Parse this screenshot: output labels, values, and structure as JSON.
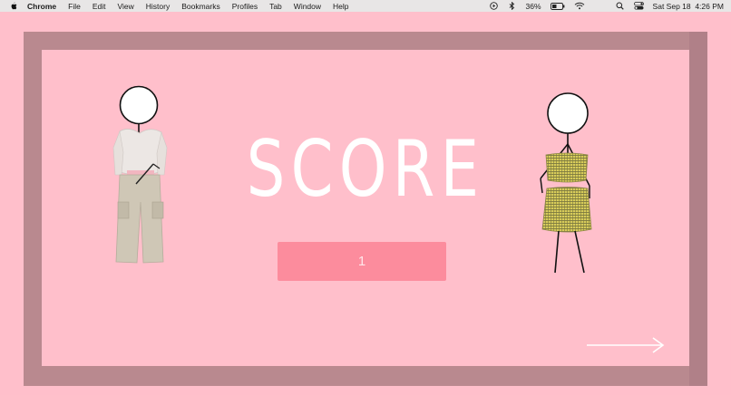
{
  "menubar": {
    "app": "Chrome",
    "items": [
      "File",
      "Edit",
      "View",
      "History",
      "Bookmarks",
      "Profiles",
      "Tab",
      "Window",
      "Help"
    ],
    "battery": "36%",
    "datetime": "Sat Sep 18  4:26 PM"
  },
  "game": {
    "title": "SCORE",
    "score": "1",
    "colors": {
      "background": "#ffbfcb",
      "frame": "#b9898f",
      "score_box": "#fc8c9d",
      "title_text": "#ffffff"
    },
    "left_figure": {
      "outfit": "white cropped top with beige cargo pants"
    },
    "right_figure": {
      "outfit": "yellow plaid tube top and mini skirt"
    },
    "next_icon": "arrow-right-icon"
  }
}
